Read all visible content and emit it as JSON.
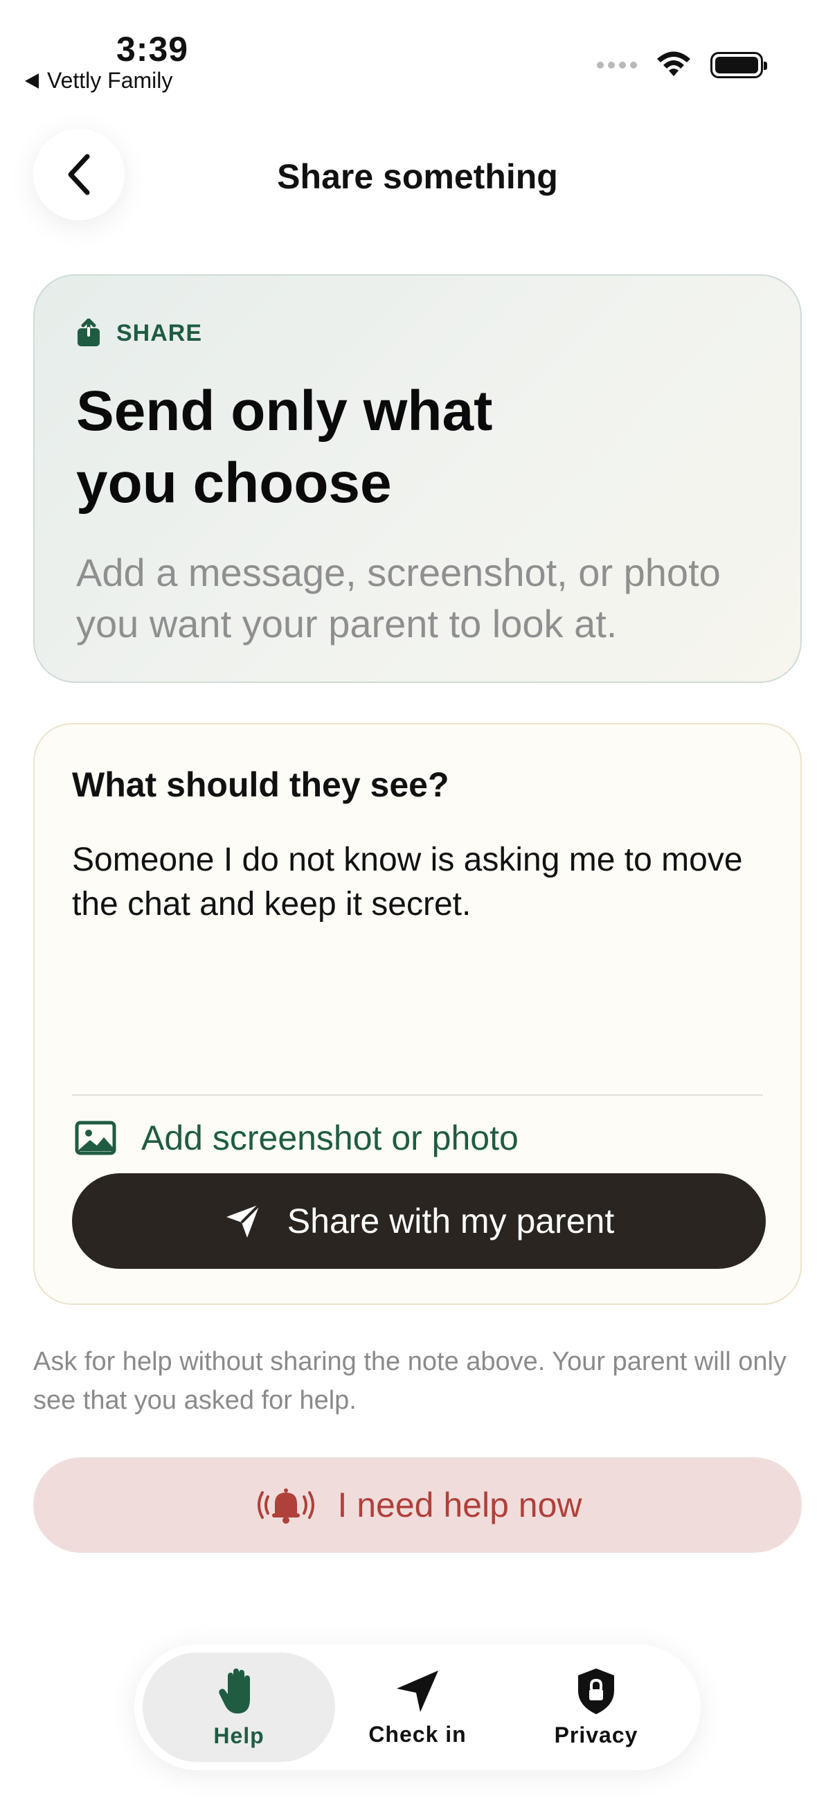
{
  "status_bar": {
    "time": "3:39",
    "back_app": "Vettly Family"
  },
  "header": {
    "title": "Share something"
  },
  "hero": {
    "tag": "SHARE",
    "title": "Send only what you choose",
    "subtitle": "Add a message, screenshot, or photo you want your parent to look at."
  },
  "compose": {
    "label": "What should they see?",
    "message": "Someone I do not know is asking me to move the chat and keep it secret.",
    "attach_label": "Add screenshot or photo",
    "share_label": "Share with my parent"
  },
  "note": "Ask for help without sharing the note above. Your parent will only see that you asked for help.",
  "help_button": {
    "label": "I need help now"
  },
  "tabbar": {
    "tabs": [
      {
        "label": "Help",
        "icon": "hand-icon",
        "active": true
      },
      {
        "label": "Check in",
        "icon": "location-arrow-icon",
        "active": false
      },
      {
        "label": "Privacy",
        "icon": "shield-lock-icon",
        "active": false
      }
    ]
  },
  "colors": {
    "accent_green": "#1f5c42",
    "dark_button": "#2a2520",
    "help_bg": "#f0dddb",
    "help_text": "#b0403a"
  }
}
